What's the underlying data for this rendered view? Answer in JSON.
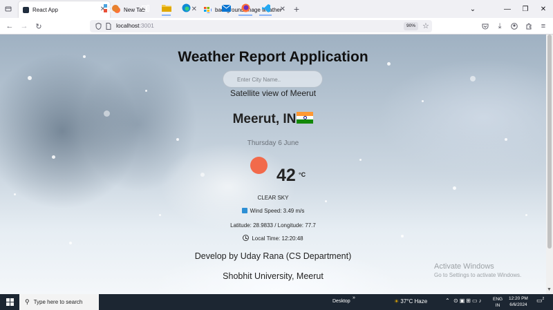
{
  "browser": {
    "tabs": [
      {
        "label": "React App",
        "active": true
      },
      {
        "label": "New Tab",
        "active": false
      },
      {
        "label": "background image weather - G",
        "active": false
      }
    ],
    "url_host": "localhost",
    "url_port": ":3001",
    "zoom": "90%"
  },
  "app": {
    "title": "Weather Report Application",
    "search_placeholder": "Enter City Name..",
    "satellite_label": "Satellite view of Meerut",
    "city": "Meerut, IN",
    "date": "Thursday 6 June",
    "temperature": "42",
    "temperature_unit": "°C",
    "condition": "CLEAR SKY",
    "wind": "Wind Speed: 3.49 m/s",
    "lat_lon": "Latitude: 28.9833 / Longitude: 77.7",
    "local_time": "Local Time: 12:20:48",
    "credit": "Develop by Uday Rana (CS Department)",
    "university": "Shobhit University, Meerut",
    "sun_color": "#f26a4b"
  },
  "watermark": {
    "line1": "Activate Windows",
    "line2": "Go to Settings to activate Windows."
  },
  "taskbar": {
    "search_text": "Type here to search",
    "desktop_label": "Desktop",
    "weather": "37°C  Haze",
    "lang_top": "ENG",
    "lang_bottom": "IN",
    "time": "12:20 PM",
    "date": "6/6/2024",
    "notification_count": "2"
  }
}
